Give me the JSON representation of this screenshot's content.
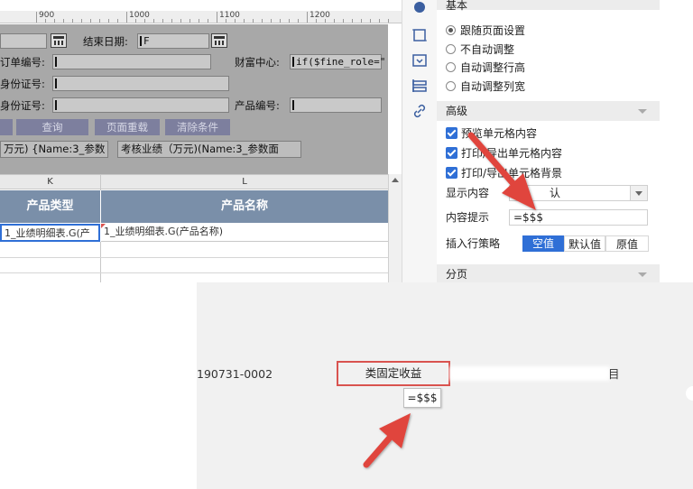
{
  "ruler": {
    "marks": [
      "900",
      "1000",
      "1100",
      "1200"
    ]
  },
  "params": {
    "end_date_label": "结束日期:",
    "end_date_value": "F",
    "order_no_label": "订单编号:",
    "wealth_center_label": "财富中心:",
    "wealth_center_value": "if($fine_role=\"",
    "id_label_1": "身份证号:",
    "id_label_2": "身份证号:",
    "product_no_label": "产品编号:",
    "query_button": "查询",
    "reset_button": "页面重载",
    "clear_button": "清除条件",
    "metric_1": "万元) {Name:3_参数",
    "metric_2": "考核业绩（万元)(Name:3_参数面"
  },
  "sheet": {
    "col_k": "K",
    "col_l": "L",
    "header_product_type": "产品类型",
    "header_product_name": "产品名称",
    "cell_product_type": "1_业绩明细表.G(产",
    "cell_product_name": "1_业绩明细表.G(产品名称)"
  },
  "props": {
    "top_section_partial": "基本",
    "radio_follow_page": "跟随页面设置",
    "radio_no_auto": "不自动调整",
    "radio_auto_row": "自动调整行高",
    "radio_auto_col": "自动调整列宽",
    "section_advanced": "高级",
    "check_preview": "预览单元格内容",
    "check_print_export": "打印/导出单元格内容",
    "check_print_bg": "打印/导出单元格背景",
    "display_content_label": "显示内容",
    "display_content_value": "认",
    "content_hint_label": "内容提示",
    "content_hint_value": "=$$$",
    "insert_policy_label": "插入行策略",
    "insert_options": [
      "空值",
      "默认值",
      "原值"
    ],
    "section_paging": "分页"
  },
  "preview": {
    "order_code": "190731-0002",
    "category_cell": "类固定收益",
    "right_text": "目",
    "tooltip": "=$$$"
  },
  "colors": {
    "accent": "#2f6fd6",
    "annotation": "#e0443e",
    "table_header": "#7a8fa9"
  }
}
